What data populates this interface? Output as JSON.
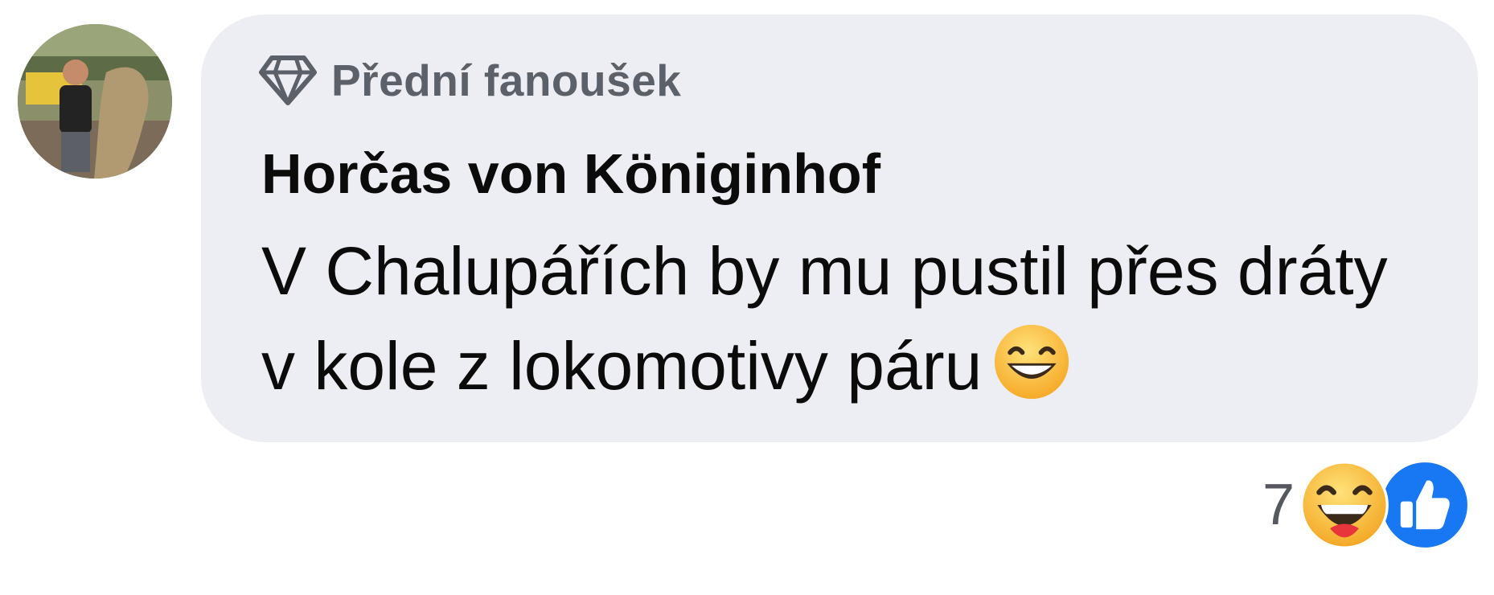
{
  "comment": {
    "avatar_icon": "user-avatar-photo",
    "badge": {
      "icon": "diamond-icon",
      "label": "Přední fanoušek"
    },
    "author": "Horčas von Königinhof",
    "text": "V Chalupářích by mu pustil přes dráty v kole z lokomotivy páru",
    "inline_emoji": "grinning-face-emoji",
    "reactions": {
      "count": "7",
      "types": [
        "haha-reaction-icon",
        "like-reaction-icon"
      ]
    }
  },
  "colors": {
    "bubble_bg": "#eceef3",
    "badge_text": "#5c6068",
    "like_blue": "#1877f2"
  }
}
